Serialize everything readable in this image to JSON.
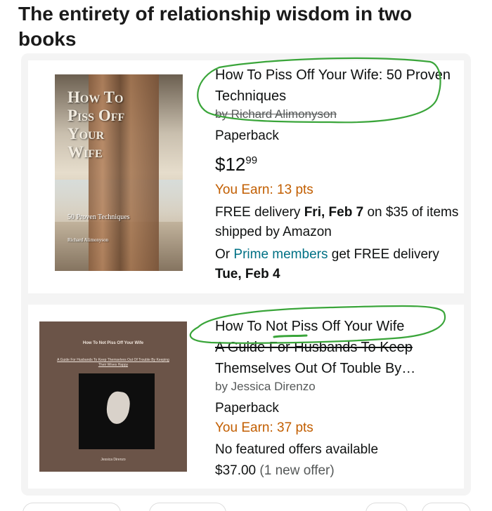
{
  "post": {
    "title": "The entirety of relationship wisdom in two books"
  },
  "products": [
    {
      "cover": {
        "title_lines": [
          "How To",
          "Piss Off",
          "Your",
          "Wife"
        ],
        "subtitle": "50 Proven Techniques",
        "author": "Richard Alimonyson"
      },
      "title": "How To Piss Off Your Wife: 50 Proven Techniques",
      "author": "by Richard Alimonyson",
      "format": "Paperback",
      "price_dollars": "$12",
      "price_cents": "99",
      "earn": "You Earn: 13 pts",
      "delivery_prefix": "FREE delivery ",
      "delivery_date": "Fri, Feb 7",
      "delivery_suffix": " on $35 of items shipped by Amazon",
      "prime_prefix": "Or ",
      "prime_link": "Prime members",
      "prime_middle": " get FREE delivery ",
      "prime_date": "Tue, Feb 4"
    },
    {
      "cover": {
        "title": "How To Not Piss Off Your Wife",
        "subtitle": "A Guide For Husbands To Keep Themselves Out Of Trouble By Keeping Their Wives Happy",
        "author": "Jessica Direnzo"
      },
      "title_main": "How To Not Piss Off Your Wife",
      "title_rest_struck": "A Guide For Husbands To Keep",
      "title_rest": " Themselves Out Of Touble By…",
      "author": "by Jessica Direnzo",
      "format": "Paperback",
      "earn": "You Earn: 37 pts",
      "offers": "No featured offers available",
      "offer_price": "$37.00",
      "offer_count": " (1 new offer)"
    }
  ],
  "annotation_color": "#3aa53a"
}
